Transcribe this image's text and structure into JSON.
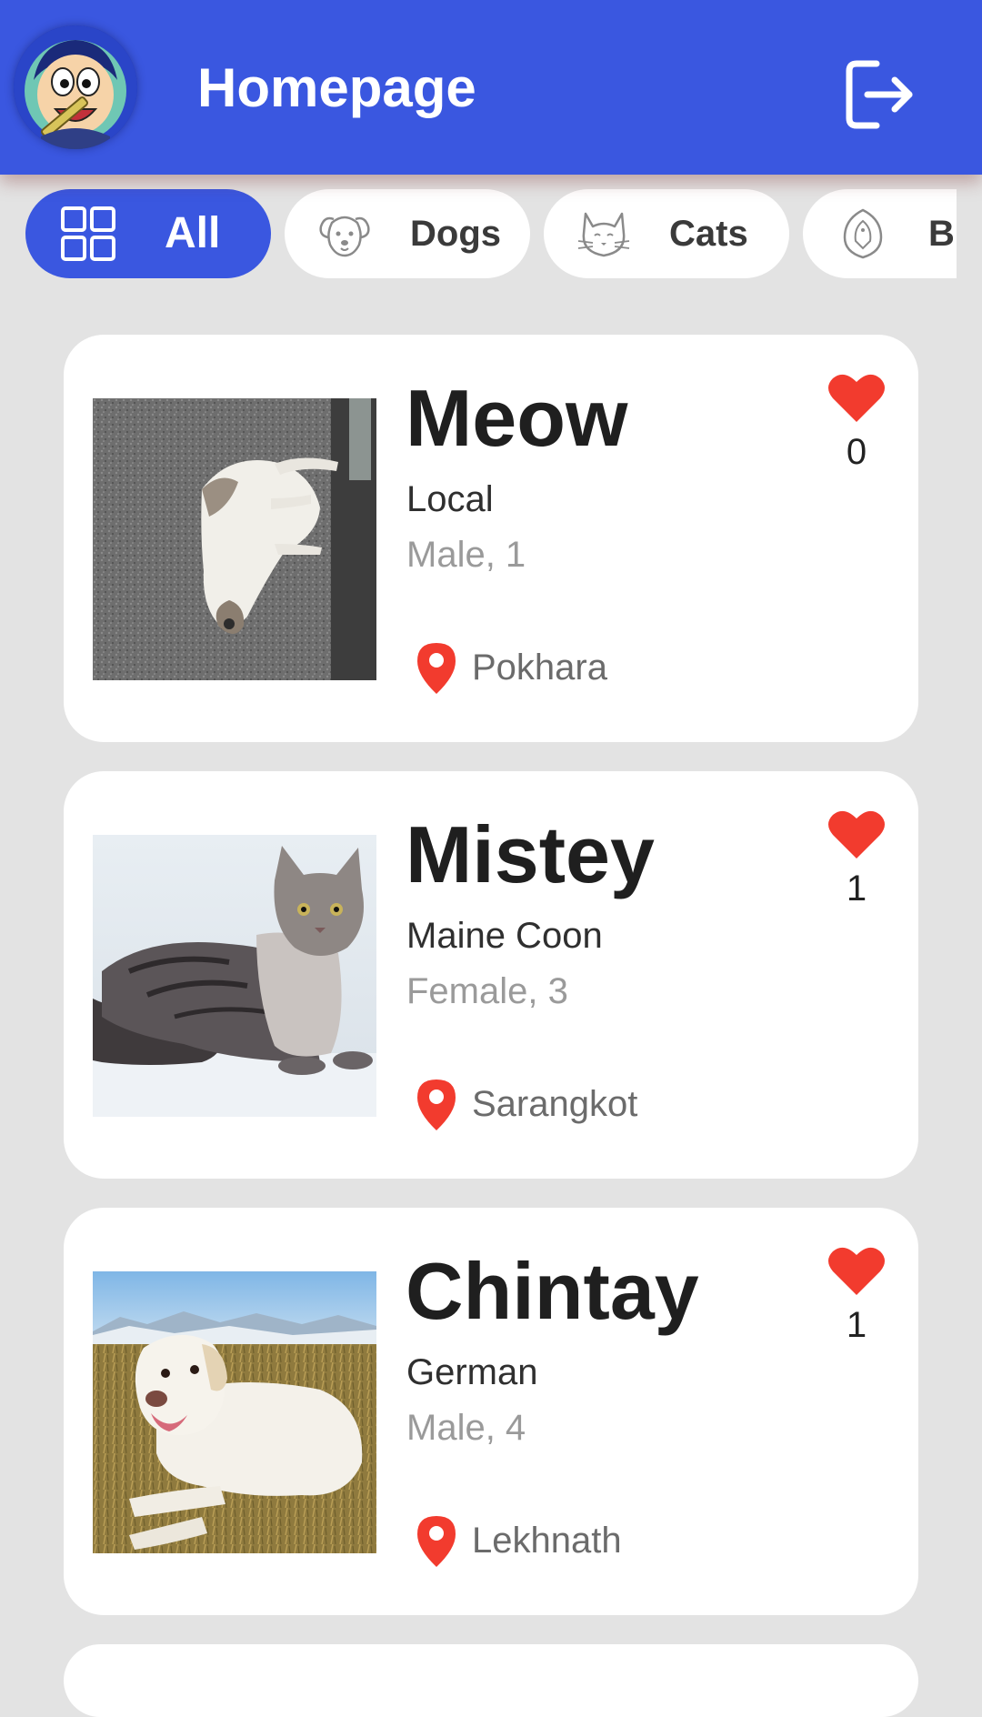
{
  "app": {
    "title": "Homepage"
  },
  "colors": {
    "primary": "#3a57e0",
    "background": "#e3e3e3",
    "heart": "#f23b2e",
    "location_pin": "#f23b2e"
  },
  "header": {
    "avatar_icon": "cartoon-avatar",
    "logout_icon": "logout-icon"
  },
  "filters": [
    {
      "label": "All",
      "icon": "grid-icon",
      "selected": true
    },
    {
      "label": "Dogs",
      "icon": "dog-icon",
      "selected": false
    },
    {
      "label": "Cats",
      "icon": "cat-icon",
      "selected": false
    },
    {
      "label": "Bi",
      "icon": "bird-icon",
      "selected": false
    }
  ],
  "pets": [
    {
      "name": "Meow",
      "breed": "Local",
      "sex_age": "Male, 1",
      "location": "Pokhara",
      "likes": "0",
      "photo": "cat-lying-on-concrete"
    },
    {
      "name": "Mistey",
      "breed": "Maine Coon",
      "sex_age": "Female, 3",
      "location": "Sarangkot",
      "likes": "1",
      "photo": "maine-coon-cat"
    },
    {
      "name": "Chintay",
      "breed": "German",
      "sex_age": "Male, 4",
      "location": "Lekhnath",
      "likes": "1",
      "photo": "white-labrador-dog"
    }
  ]
}
